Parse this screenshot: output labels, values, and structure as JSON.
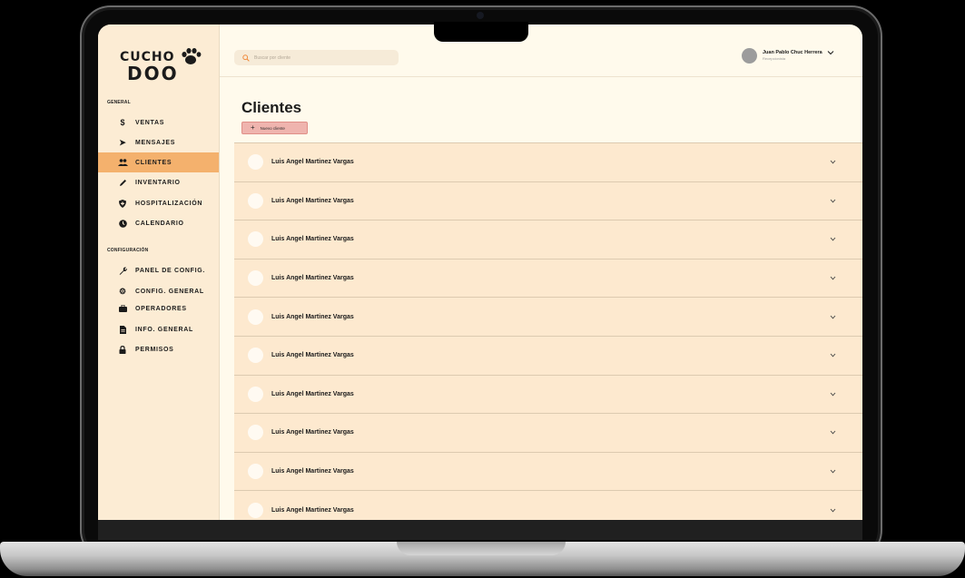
{
  "logo": {
    "line1": "CUCHO",
    "line2": "DOO"
  },
  "sidebar": {
    "sections": [
      {
        "label": "GENERAL"
      },
      {
        "label": "CONFIGURACIÓN"
      }
    ],
    "items": [
      {
        "label": "VENTAS",
        "icon": "dollar-icon",
        "glyph": "$",
        "active": false
      },
      {
        "label": "MENSAJES",
        "icon": "send-icon",
        "glyph": "➤",
        "active": false
      },
      {
        "label": "CLIENTES",
        "icon": "users-icon",
        "glyph": "👥",
        "active": true
      },
      {
        "label": "INVENTARIO",
        "icon": "pencil-icon",
        "glyph": "✎",
        "active": false
      },
      {
        "label": "HOSPITALIZACIÓN",
        "icon": "shield-icon",
        "glyph": "⛨",
        "active": false
      },
      {
        "label": "CALENDARIO",
        "icon": "clock-icon",
        "glyph": "◷",
        "active": false
      },
      {
        "label": "PANEL DE CONFIG.",
        "icon": "wrench-icon",
        "glyph": "🔧",
        "active": false
      },
      {
        "label": "CONFIG. GENERAL",
        "icon": "gear-icon",
        "glyph": "⚙",
        "active": false
      },
      {
        "label": "OPERADORES",
        "icon": "briefcase-icon",
        "glyph": "■",
        "active": false
      },
      {
        "label": "INFO. GENERAL",
        "icon": "document-icon",
        "glyph": "▤",
        "active": false
      },
      {
        "label": "PERMISOS",
        "icon": "lock-icon",
        "glyph": "🔒",
        "active": false
      }
    ]
  },
  "header": {
    "search_placeholder": "Buscar por cliente",
    "user_name": "Juan Pablo Chuc Herrera",
    "user_role": "Recepcionista"
  },
  "main": {
    "title": "Clientes",
    "new_button_label": "Nuevo cliente",
    "clients": [
      "Luis Angel Martinez Vargas",
      "Luis Angel Martinez Vargas",
      "Luis Angel Martinez Vargas",
      "Luis Angel Martinez Vargas",
      "Luis Angel Martinez Vargas",
      "Luis Angel Martinez Vargas",
      "Luis Angel Martinez Vargas",
      "Luis Angel Martinez Vargas",
      "Luis Angel Martinez Vargas",
      "Luis Angel Martinez Vargas"
    ]
  },
  "colors": {
    "accent": "#f4b16d",
    "sidebar_bg": "#fcecd4",
    "row_bg": "#fde9cf",
    "button_bg": "#efb4ae",
    "screen_bg": "#fffaec"
  }
}
